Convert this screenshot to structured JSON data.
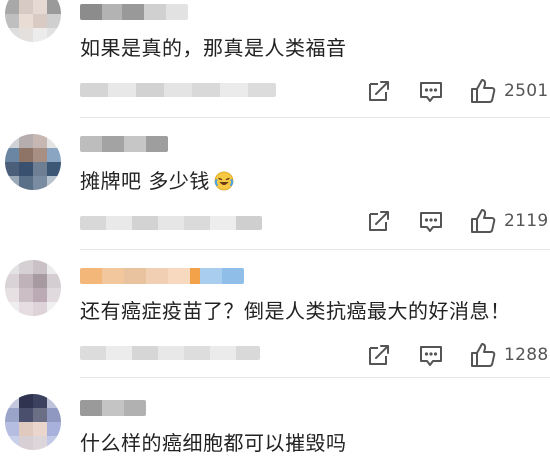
{
  "comments": [
    {
      "text": "如果是真的，那真是人类福音",
      "emoji": "",
      "likes": "2501"
    },
    {
      "text": "摊牌吧 多少钱",
      "emoji": "laughing-crying-emoji",
      "likes": "2119"
    },
    {
      "text": "还有癌症疫苗了？倒是人类抗癌最大的好消息！",
      "emoji": "",
      "likes": "1288"
    },
    {
      "text": "什么样的癌细胞都可以摧毁吗",
      "emoji": "",
      "likes": ""
    }
  ],
  "icons": {
    "share": "share-icon",
    "comment": "comment-icon",
    "like": "thumbs-up-icon"
  },
  "colors": {
    "text": "#222222",
    "icon": "#555555",
    "divider": "#e6e6e6",
    "username_highlight": "#f3b77a"
  }
}
